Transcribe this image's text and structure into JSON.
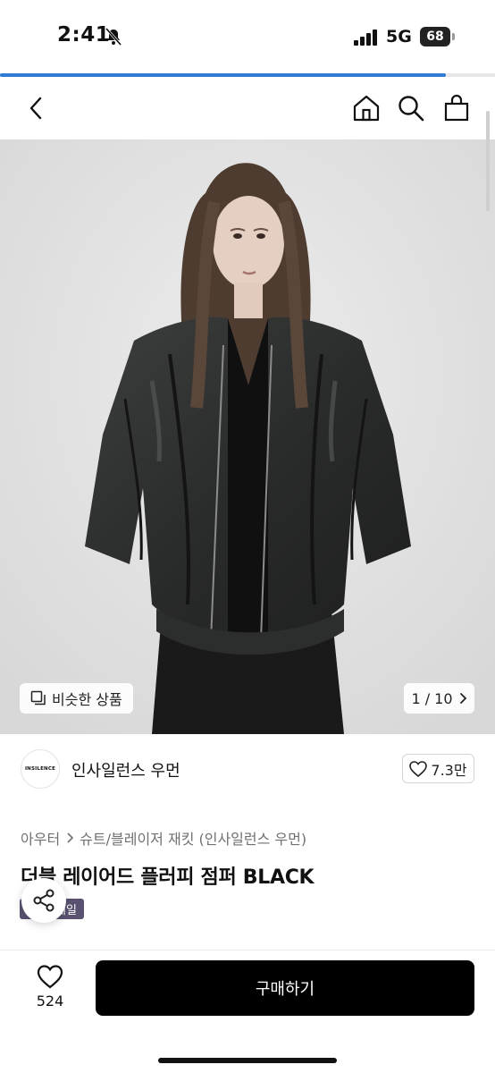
{
  "status_bar": {
    "time": "2:41",
    "network": "5G",
    "battery": "68",
    "icons": [
      "bell-slash-icon",
      "signal-icon",
      "battery-icon"
    ]
  },
  "page_load_progress": 0.9,
  "nav": {
    "back_icon": "chevron-left-icon",
    "home_icon": "home-icon",
    "search_icon": "search-icon",
    "cart_icon": "shopping-bag-icon"
  },
  "gallery": {
    "similar_label": "비슷한 상품",
    "counter": "1 / 10"
  },
  "seller": {
    "logo_text": "INSILENCE",
    "name": "인사일런스 우먼",
    "likes": "7.3만"
  },
  "breadcrumb": {
    "category": "아우터",
    "subcategory": "슈트/블레이저 재킷 (인사일런스 우먼)"
  },
  "product": {
    "title": "더블 레이어드 플러피 점퍼 BLACK",
    "badge": "세일"
  },
  "bottom_bar": {
    "wish_count": "524",
    "buy_label": "구매하기"
  },
  "colors": {
    "accent": "#2f7bd6",
    "buy_button": "#000000",
    "badge": "#5a5270"
  }
}
